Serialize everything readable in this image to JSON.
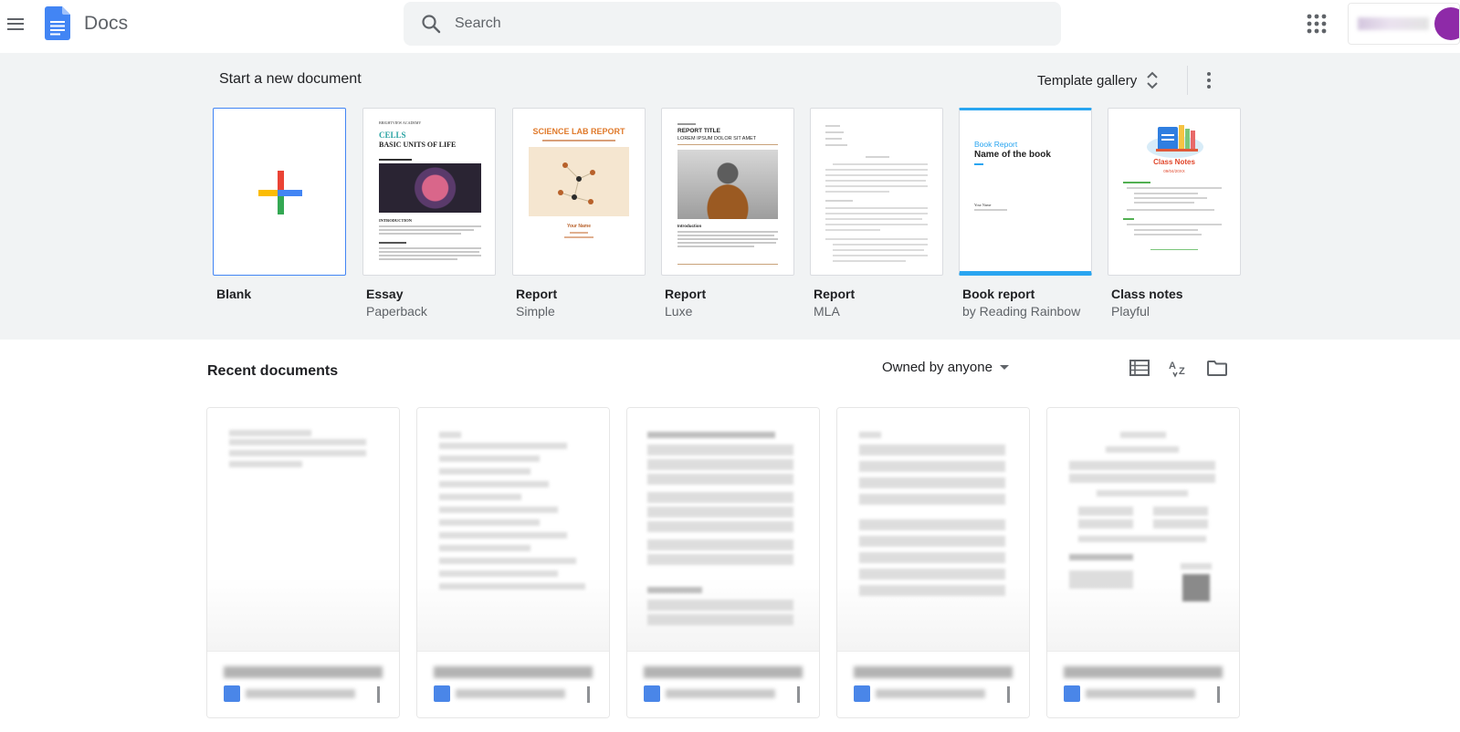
{
  "header": {
    "app_name": "Docs",
    "search_placeholder": "Search",
    "icons": [
      "main-menu-icon",
      "docs-logo-icon",
      "search-icon",
      "apps-grid-icon",
      "avatar"
    ]
  },
  "templates": {
    "section_title": "Start a new document",
    "gallery_label": "Template gallery",
    "items": [
      {
        "name": "Blank",
        "sub": ""
      },
      {
        "name": "Essay",
        "sub": "Paperback",
        "preview": {
          "header": "BRIGHTVIEW ACADEMY",
          "title_a": "CELLS",
          "title_b": "BASIC UNITS OF LIFE",
          "section": "INTRODUCTION"
        }
      },
      {
        "name": "Report",
        "sub": "Simple",
        "preview": {
          "title": "SCIENCE LAB REPORT",
          "author": "Your Name"
        }
      },
      {
        "name": "Report",
        "sub": "Luxe",
        "preview": {
          "title": "REPORT TITLE",
          "subtitle": "LOREM IPSUM DOLOR SIT AMET",
          "section": "Introduction"
        }
      },
      {
        "name": "Report",
        "sub": "MLA",
        "preview": {}
      },
      {
        "name": "Book report",
        "sub": "by Reading Rainbow",
        "preview": {
          "label": "Book Report",
          "title": "Name of the book",
          "author": "Your Name"
        }
      },
      {
        "name": "Class notes",
        "sub": "Playful",
        "preview": {
          "title": "Class Notes",
          "date": "09/04/20XX"
        }
      }
    ]
  },
  "recent": {
    "section_title": "Recent documents",
    "owner_filter": "Owned by anyone",
    "view_icons": [
      "list-view-icon",
      "sort-az-icon",
      "folder-icon"
    ]
  },
  "colors": {
    "docs_blue": "#4285f4",
    "gallery_bg": "#f1f3f4",
    "text_primary": "#202124",
    "text_secondary": "#5f6368",
    "avatar": "#8e2aa8"
  }
}
